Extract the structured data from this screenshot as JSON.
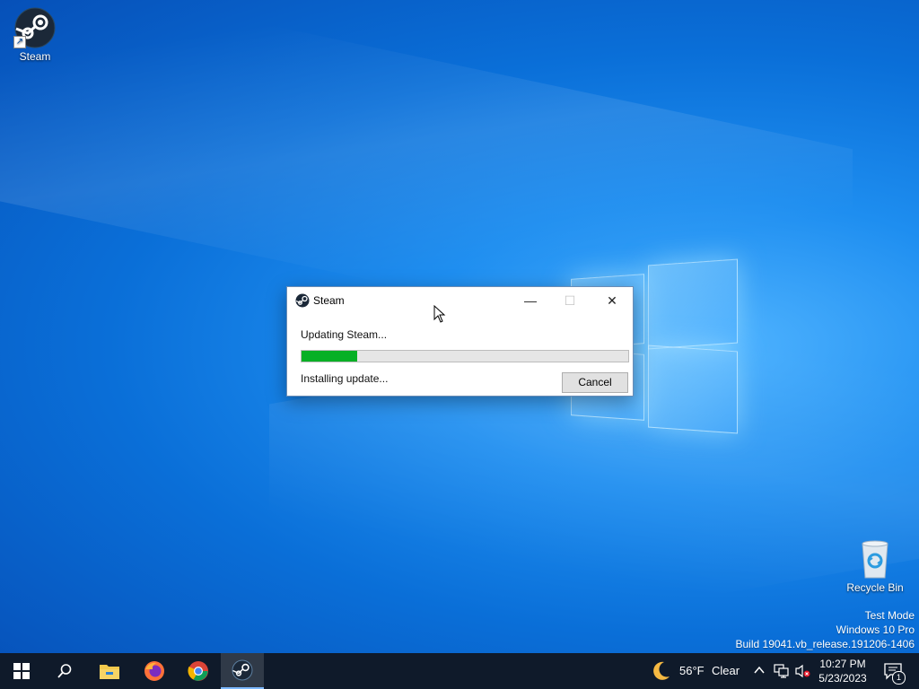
{
  "desktop": {
    "icons": [
      {
        "label": "Steam"
      },
      {
        "label": "Recycle Bin"
      }
    ],
    "watermark": {
      "line1": "Test Mode",
      "line2": "Windows 10 Pro",
      "line3": "Build 19041.vb_release.191206-1406"
    }
  },
  "dialog": {
    "title": "Steam",
    "minimize_glyph": "—",
    "maximize_glyph": "☐",
    "close_glyph": "✕",
    "status_text": "Updating Steam...",
    "progress_fraction": 0.17,
    "progress_color": "#06b025",
    "detail_text": "Installing update...",
    "cancel_label": "Cancel"
  },
  "taskbar": {
    "items": [
      {
        "icon": "windows-start-icon"
      },
      {
        "icon": "search-icon"
      },
      {
        "icon": "file-explorer-icon"
      },
      {
        "icon": "firefox-icon"
      },
      {
        "icon": "chrome-icon"
      },
      {
        "icon": "steam-icon",
        "active": true
      }
    ],
    "weather": {
      "temp": "56°F",
      "condition": "Clear",
      "icon": "moon-icon"
    },
    "clock": {
      "time": "10:27 PM",
      "date": "5/23/2023"
    },
    "notification_count": "1"
  }
}
